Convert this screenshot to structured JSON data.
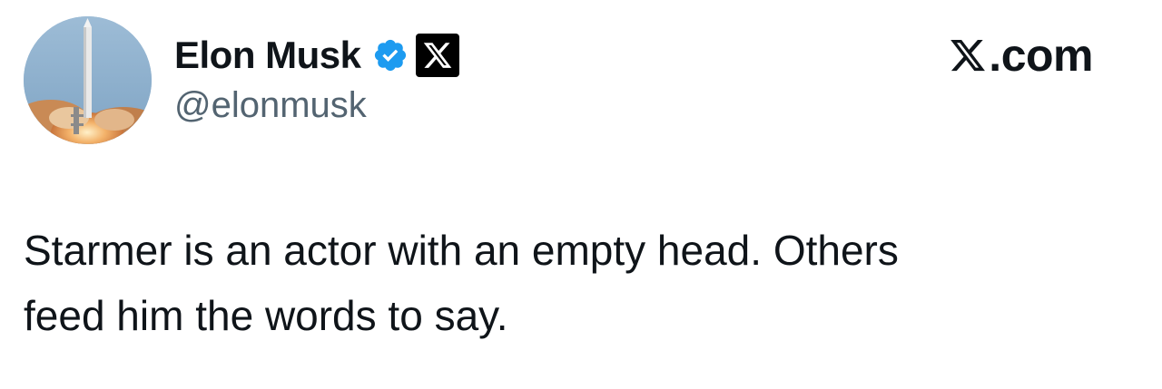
{
  "author": {
    "display_name": "Elon Musk",
    "handle": "@elonmusk",
    "verified_badge_color": "#1d9bf0",
    "avatar_icon": "rocket-launch-avatar",
    "affiliate_badge_icon": "x-logo-icon"
  },
  "brand": {
    "logo_icon": "x-logo-icon",
    "text": ".com"
  },
  "tweet": {
    "lines": [
      "Starmer is an actor with an empty head. Others",
      "feed him the words to say."
    ]
  }
}
